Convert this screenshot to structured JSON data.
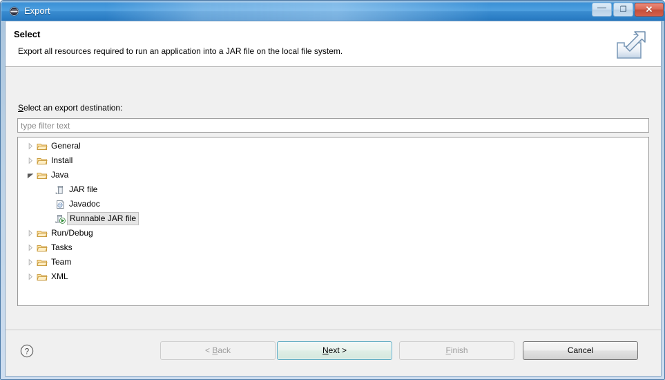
{
  "window": {
    "title": "Export",
    "app_icon": "eclipse-sphere-icon",
    "frame_accent": "#4b7aa8",
    "titlebar_color": "#3d93d8",
    "controls": [
      {
        "name": "minimize-button",
        "glyph": "—",
        "tooltip": "Minimize"
      },
      {
        "name": "maximize-button",
        "glyph": "❐",
        "tooltip": "Maximize"
      },
      {
        "name": "close-button",
        "glyph": "✕",
        "tooltip": "Close"
      }
    ]
  },
  "banner": {
    "title": "Select",
    "description": "Export all resources required to run an application into a JAR file on the local file system.",
    "icon": "export-tray-arrow-icon"
  },
  "body": {
    "destination_label_mnemonic": "S",
    "destination_label_rest": "elect an export destination:",
    "filter": {
      "placeholder": "type filter text",
      "value": ""
    }
  },
  "tree": {
    "items": [
      {
        "label": "General",
        "icon": "folder-icon",
        "indent": 0,
        "state": "collapsed",
        "selected": false
      },
      {
        "label": "Install",
        "icon": "folder-icon",
        "indent": 0,
        "state": "collapsed",
        "selected": false
      },
      {
        "label": "Java",
        "icon": "folder-icon",
        "indent": 0,
        "state": "expanded",
        "selected": false
      },
      {
        "label": "JAR file",
        "icon": "jar-file-icon",
        "indent": 1,
        "state": "leaf",
        "selected": false
      },
      {
        "label": "Javadoc",
        "icon": "javadoc-icon",
        "indent": 1,
        "state": "leaf",
        "selected": false
      },
      {
        "label": "Runnable JAR file",
        "icon": "runnable-jar-icon",
        "indent": 1,
        "state": "leaf",
        "selected": true
      },
      {
        "label": "Run/Debug",
        "icon": "folder-icon",
        "indent": 0,
        "state": "collapsed",
        "selected": false
      },
      {
        "label": "Tasks",
        "icon": "folder-icon",
        "indent": 0,
        "state": "collapsed",
        "selected": false
      },
      {
        "label": "Team",
        "icon": "folder-icon",
        "indent": 0,
        "state": "collapsed",
        "selected": false
      },
      {
        "label": "XML",
        "icon": "folder-icon",
        "indent": 0,
        "state": "collapsed",
        "selected": false
      }
    ]
  },
  "footer": {
    "help_icon": "help-question-icon",
    "buttons": {
      "back": {
        "prefix": "< ",
        "mnemonic": "B",
        "suffix": "ack",
        "enabled": false,
        "is_default": false
      },
      "next": {
        "prefix": "",
        "mnemonic": "N",
        "suffix": "ext >",
        "enabled": true,
        "is_default": true
      },
      "finish": {
        "prefix": "",
        "mnemonic": "F",
        "suffix": "inish",
        "enabled": false,
        "is_default": false
      },
      "cancel": {
        "prefix": "",
        "mnemonic": "",
        "suffix": "Cancel",
        "enabled": true,
        "is_default": false
      }
    }
  }
}
